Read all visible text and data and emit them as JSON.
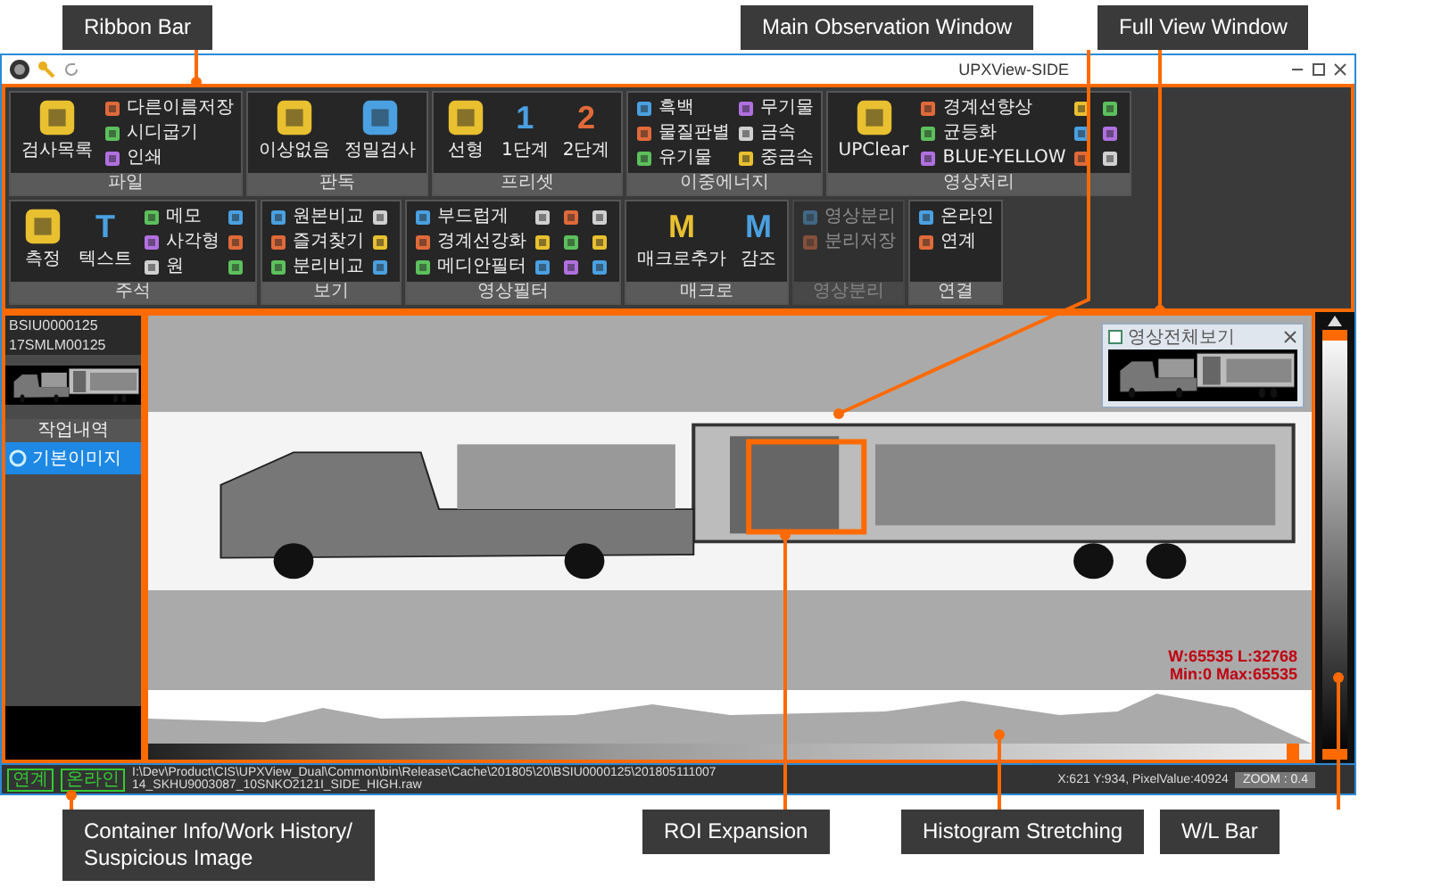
{
  "callouts_top": [
    {
      "label": "Ribbon Bar"
    },
    {
      "label": "Main Observation Window"
    },
    {
      "label": "Full View Window"
    }
  ],
  "callouts_bottom": [
    {
      "label": "Container Info/Work History/\nSuspicious Image"
    },
    {
      "label": "ROI Expansion"
    },
    {
      "label": "Histogram Stretching"
    },
    {
      "label": "W/L Bar"
    }
  ],
  "window": {
    "title": "UPXView-SIDE"
  },
  "ribbon": {
    "rows": [
      {
        "groups": [
          {
            "label": "파일",
            "disabled": false,
            "items": [
              {
                "kind": "large",
                "label": "검사목록"
              },
              {
                "kind": "small",
                "label": "다른이름저장"
              },
              {
                "kind": "small",
                "label": "시디굽기"
              },
              {
                "kind": "small",
                "label": "인쇄"
              }
            ]
          },
          {
            "label": "판독",
            "disabled": false,
            "items": [
              {
                "kind": "large",
                "label": "이상없음"
              },
              {
                "kind": "large",
                "label": "정밀검사"
              }
            ]
          },
          {
            "label": "프리셋",
            "disabled": false,
            "items": [
              {
                "kind": "large",
                "label": "선형"
              },
              {
                "kind": "large",
                "glyph": "1",
                "label": "1단계"
              },
              {
                "kind": "large",
                "glyph": "2",
                "label": "2단계"
              }
            ]
          },
          {
            "label": "이중에너지",
            "disabled": false,
            "items": [
              {
                "kind": "small",
                "label": "흑백"
              },
              {
                "kind": "small",
                "label": "물질판별"
              },
              {
                "kind": "small",
                "label": "유기물"
              },
              {
                "kind": "small",
                "label": "무기물"
              },
              {
                "kind": "small",
                "label": "금속"
              },
              {
                "kind": "small",
                "label": "중금속"
              }
            ]
          },
          {
            "label": "영상처리",
            "disabled": false,
            "items": [
              {
                "kind": "large",
                "label": "UPClear"
              },
              {
                "kind": "small",
                "label": "경계선향상"
              },
              {
                "kind": "small",
                "label": "균등화"
              },
              {
                "kind": "small",
                "label": "BLUE-YELLOW"
              },
              {
                "kind": "icon"
              },
              {
                "kind": "icon"
              },
              {
                "kind": "icon"
              },
              {
                "kind": "icon"
              },
              {
                "kind": "icon"
              },
              {
                "kind": "icon"
              }
            ]
          }
        ]
      },
      {
        "groups": [
          {
            "label": "주석",
            "disabled": false,
            "items": [
              {
                "kind": "large",
                "label": "측정"
              },
              {
                "kind": "large",
                "glyph": "T",
                "label": "텍스트"
              },
              {
                "kind": "small",
                "label": "메모"
              },
              {
                "kind": "small",
                "label": "사각형"
              },
              {
                "kind": "small",
                "label": "원"
              },
              {
                "kind": "icon"
              },
              {
                "kind": "icon"
              },
              {
                "kind": "icon"
              }
            ]
          },
          {
            "label": "보기",
            "disabled": false,
            "items": [
              {
                "kind": "small",
                "label": "원본비교"
              },
              {
                "kind": "small",
                "label": "즐겨찾기"
              },
              {
                "kind": "small",
                "label": "분리비교"
              },
              {
                "kind": "icon"
              },
              {
                "kind": "icon"
              },
              {
                "kind": "icon"
              }
            ]
          },
          {
            "label": "영상필터",
            "disabled": false,
            "items": [
              {
                "kind": "small",
                "label": "부드럽게"
              },
              {
                "kind": "small",
                "label": "경계선강화"
              },
              {
                "kind": "small",
                "label": "메디안필터"
              },
              {
                "kind": "icon"
              },
              {
                "kind": "icon"
              },
              {
                "kind": "icon"
              },
              {
                "kind": "icon"
              },
              {
                "kind": "icon"
              },
              {
                "kind": "icon"
              },
              {
                "kind": "icon"
              },
              {
                "kind": "icon"
              },
              {
                "kind": "icon"
              }
            ]
          },
          {
            "label": "매크로",
            "disabled": false,
            "items": [
              {
                "kind": "large",
                "glyph": "M",
                "label": "매크로추가"
              },
              {
                "kind": "large",
                "glyph": "M",
                "label": "감조"
              }
            ]
          },
          {
            "label": "영상분리",
            "disabled": true,
            "items": [
              {
                "kind": "small",
                "label": "영상분리"
              },
              {
                "kind": "small",
                "label": "분리저장"
              }
            ]
          },
          {
            "label": "연결",
            "disabled": false,
            "items": [
              {
                "kind": "small",
                "label": "온라인"
              },
              {
                "kind": "small",
                "label": "연계"
              }
            ]
          }
        ]
      }
    ]
  },
  "container_info": [
    "BSIU0000125",
    "17SMLM00125"
  ],
  "work_history": {
    "title": "작업내역",
    "items": [
      {
        "label": "기본이미지",
        "selected": true
      }
    ]
  },
  "full_view": {
    "title": "영상전체보기"
  },
  "histogram_stretch": {
    "level": 0.99
  },
  "readout": [
    "W:65535  L:32768",
    "Min:0  Max:65535"
  ],
  "status_bar": {
    "badges": [
      "연계",
      "온라인"
    ],
    "path": "I:\\Dev\\Product\\CIS\\UPXView_Dual\\Common\\bin\\Release\\Cache\\201805\\20\\BSIU0000125\\20180511100714_SKHU9003087_10SNKO2121I_SIDE_HIGH.raw",
    "position": "X:621 Y:934, PixelValue:40924",
    "zoom": "ZOOM : 0.4"
  }
}
